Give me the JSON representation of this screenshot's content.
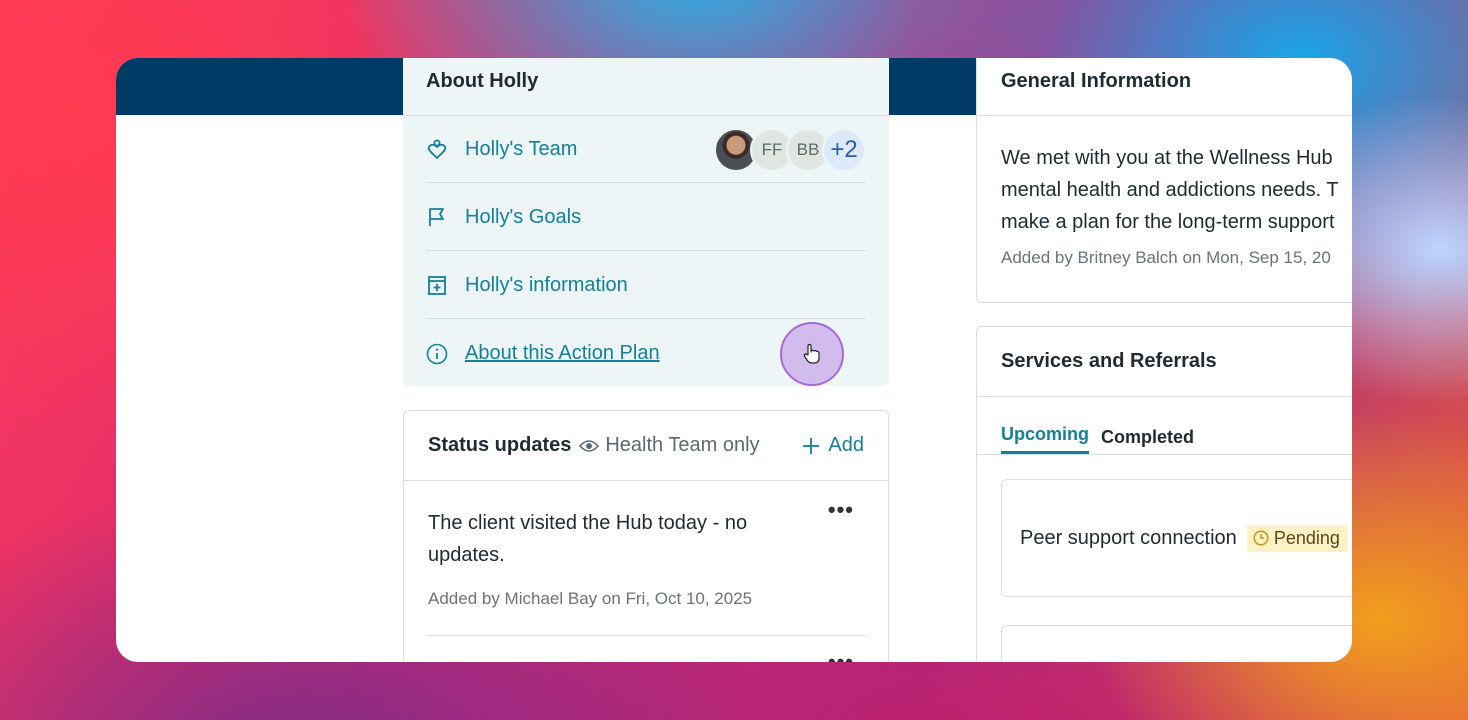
{
  "about": {
    "title": "About Holly",
    "items": [
      {
        "label": "Holly's Team",
        "icon": "team-icon"
      },
      {
        "label": "Holly's Goals",
        "icon": "flag-icon"
      },
      {
        "label": "Holly's information",
        "icon": "document-plus-icon"
      },
      {
        "label": "About this Action Plan",
        "icon": "info-icon"
      }
    ],
    "team_avatars": [
      "FF",
      "BB"
    ],
    "team_more": "+2"
  },
  "status_updates": {
    "title": "Status updates",
    "visibility": "Health Team only",
    "add_label": "Add",
    "menu_label": "•••",
    "entries": [
      {
        "text": "The client visited the Hub today - no updates.",
        "meta": "Added by Michael Bay on Fri, Oct 10, 2025"
      }
    ]
  },
  "general_information": {
    "title": "General Information",
    "lines": [
      "We met with you at the Wellness Hub",
      "mental health and addictions needs. T",
      "make a plan for the long-term support"
    ],
    "meta": "Added by Britney Balch on Mon, Sep 15, 20"
  },
  "services": {
    "title": "Services and Referrals",
    "tabs": [
      "Upcoming",
      "Completed"
    ],
    "items": [
      {
        "label": "Peer support connection",
        "status": "Pending"
      }
    ]
  },
  "colors": {
    "header": "#003b65",
    "accent": "#11829a",
    "panel": "#eef5f7",
    "pending_bg": "#fdf1c8"
  }
}
